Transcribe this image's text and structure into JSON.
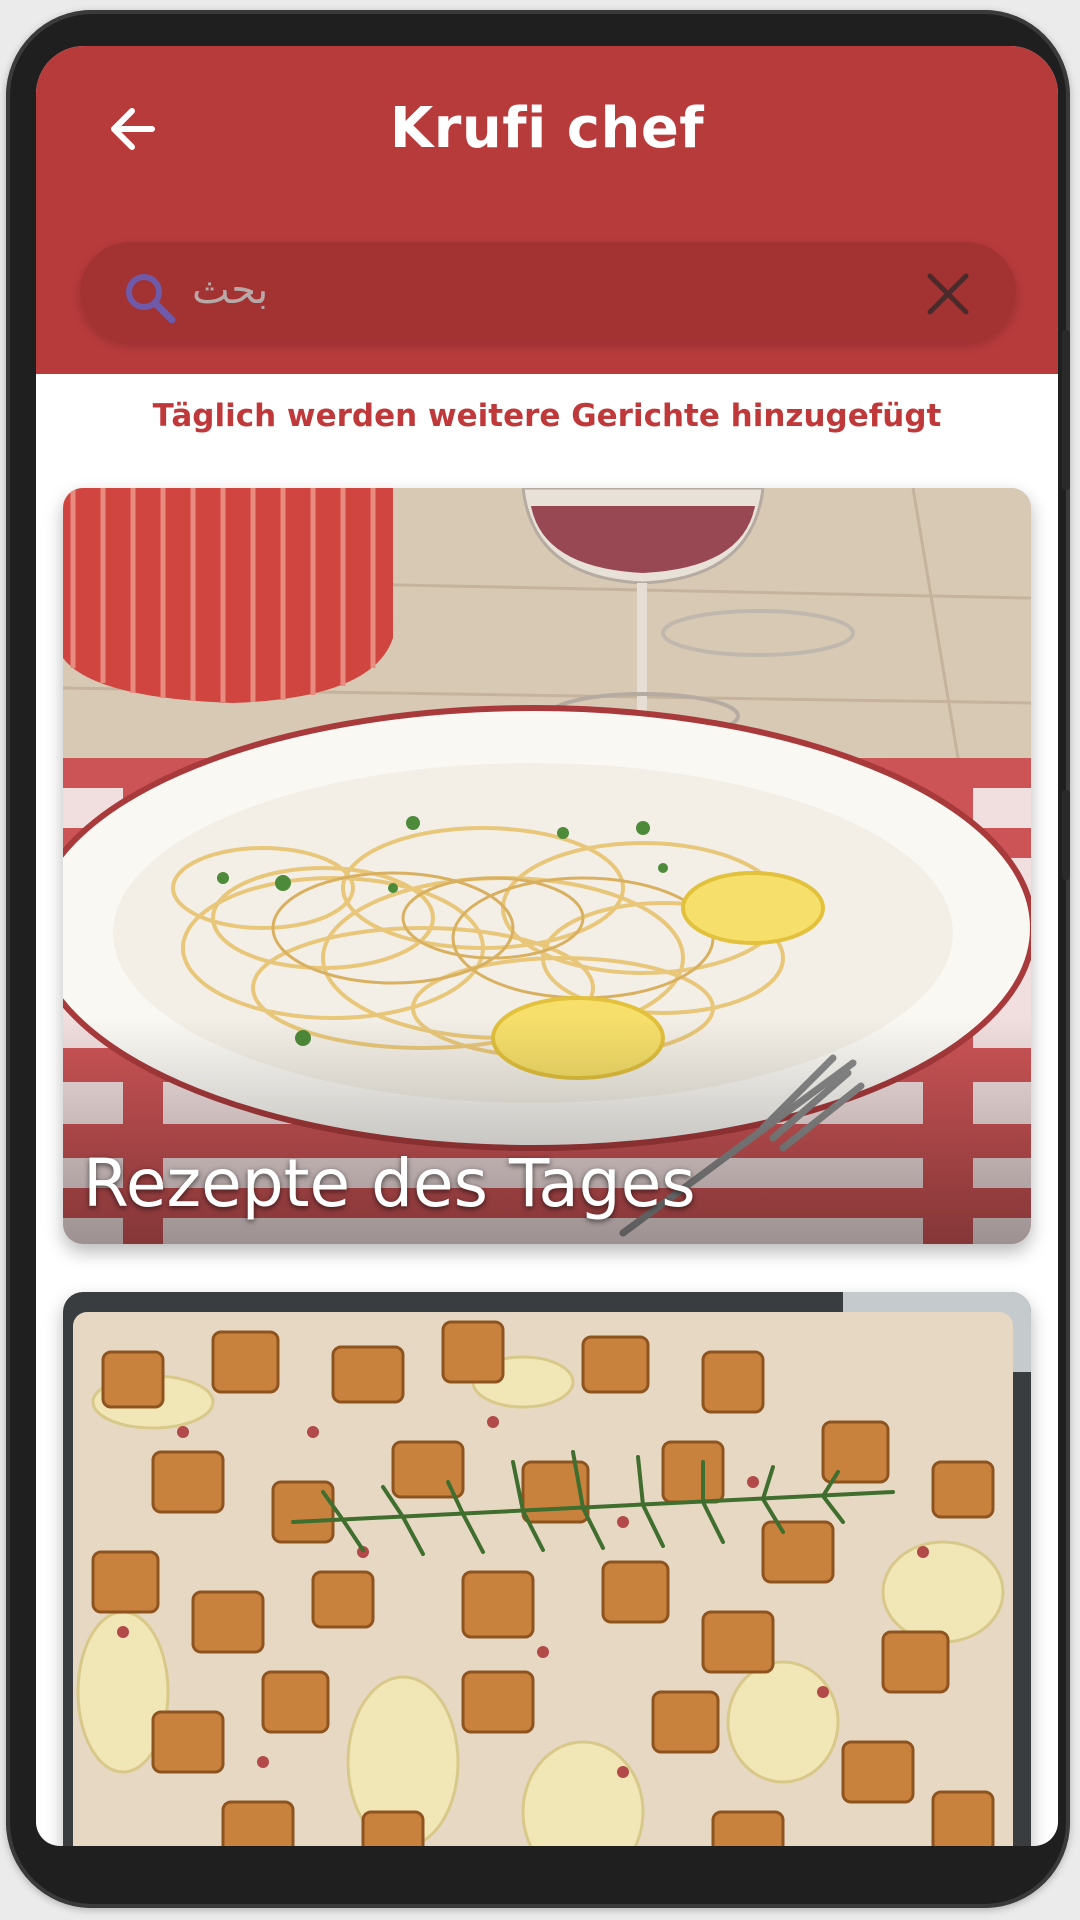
{
  "appbar": {
    "title": "Krufi chef"
  },
  "search": {
    "placeholder": "بحث"
  },
  "subtitle": "Täglich werden weitere Gerichte hinzugefügt",
  "cards": [
    {
      "label": "Rezepte des Tages",
      "image": "spaghetti-lemon-plate"
    },
    {
      "label": "",
      "image": "potato-gratin-croutons"
    }
  ],
  "colors": {
    "brand": "#b83b3c",
    "search_bg": "#a33232",
    "subtitle": "#c0393a"
  },
  "icons": {
    "back": "arrow-left-icon",
    "search": "search-icon",
    "clear": "close-icon"
  }
}
